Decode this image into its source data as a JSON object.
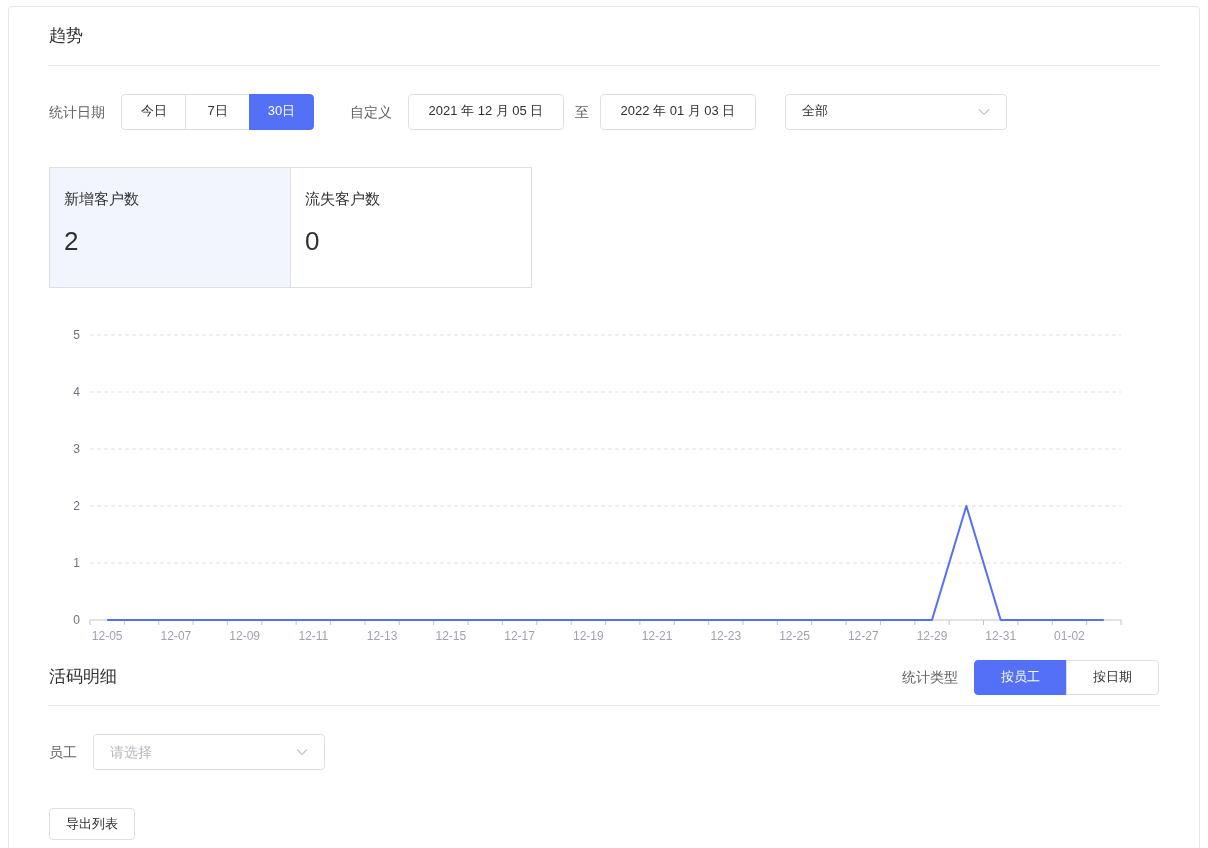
{
  "trend": {
    "title": "趋势",
    "filter": {
      "label": "统计日期",
      "ranges": [
        {
          "label": "今日",
          "selected": false
        },
        {
          "label": "7日",
          "selected": false
        },
        {
          "label": "30日",
          "selected": true
        }
      ],
      "custom_label": "自定义",
      "start_date": "2021 年 12 月 05 日",
      "separator": "至",
      "end_date": "2022 年 01 月 03 日",
      "scope": "全部"
    },
    "stats": [
      {
        "label": "新增客户数",
        "value": "2",
        "selected": true
      },
      {
        "label": "流失客户数",
        "value": "0",
        "selected": false
      }
    ],
    "chart_data": {
      "type": "line",
      "grid": true,
      "categories": [
        "12-05",
        null,
        "12-07",
        null,
        "12-09",
        null,
        "12-11",
        null,
        "12-13",
        null,
        "12-15",
        null,
        "12-17",
        null,
        "12-19",
        null,
        "12-21",
        null,
        "12-23",
        null,
        "12-25",
        null,
        "12-27",
        null,
        "12-29",
        null,
        "12-31",
        null,
        "01-02",
        null
      ],
      "series": [
        {
          "color": "#5470f6",
          "values": [
            0,
            0,
            0,
            0,
            0,
            0,
            0,
            0,
            0,
            0,
            0,
            0,
            0,
            0,
            0,
            0,
            0,
            0,
            0,
            0,
            0,
            0,
            0,
            0,
            0,
            2,
            0,
            0,
            0,
            0
          ]
        }
      ],
      "ylim": [
        0,
        5
      ],
      "yticks": [
        0,
        1,
        2,
        3,
        4,
        5
      ]
    }
  },
  "detail": {
    "title": "活码明细",
    "type_label": "统计类型",
    "types": [
      {
        "label": "按员工",
        "selected": true
      },
      {
        "label": "按日期",
        "selected": false
      }
    ],
    "employee_label": "员工",
    "employee_placeholder": "请选择",
    "export": "导出列表"
  }
}
